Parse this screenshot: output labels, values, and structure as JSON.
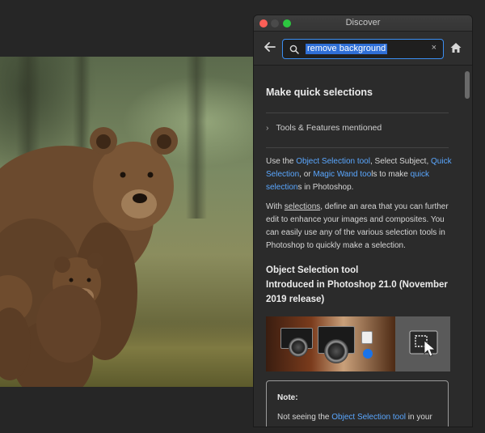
{
  "window": {
    "title": "Discover"
  },
  "search": {
    "query": "remove background",
    "clear_label": "×"
  },
  "icons": {
    "back": "arrow-left-icon",
    "search": "search-icon",
    "home": "home-icon",
    "chevron": "chevron-right-icon"
  },
  "colors": {
    "accent": "#3b8ef2",
    "link": "#5aa7ff",
    "panel_bg": "#2b2b2b",
    "selection": "#2f6fd6"
  },
  "article": {
    "heading": "Make quick selections",
    "tools_row": "Tools & Features mentioned",
    "para1": {
      "t1": "Use the ",
      "l1": "Object Selection tool",
      "t2": ", Select Subject, ",
      "l2": "Quick Selection",
      "t3": ", or ",
      "l3": "Magic Wand too",
      "t4": "ls to make ",
      "l4": "quick selection",
      "t5": "s in Photoshop."
    },
    "para2": {
      "t1": "With ",
      "u1": "selections",
      "t2": ", define an area that you can further edit to enhance your images and composites. You can easily use any of the various selection tools in Photoshop to quickly make a selection."
    },
    "sub1": "Object Selection tool",
    "sub2": "Introduced in Photoshop 21.0 (November",
    "sub3": "2019 release)",
    "note": {
      "title": "Note:",
      "t1": "Not seeing the ",
      "l1": "Object Selection tool",
      "t2": " in your"
    }
  }
}
